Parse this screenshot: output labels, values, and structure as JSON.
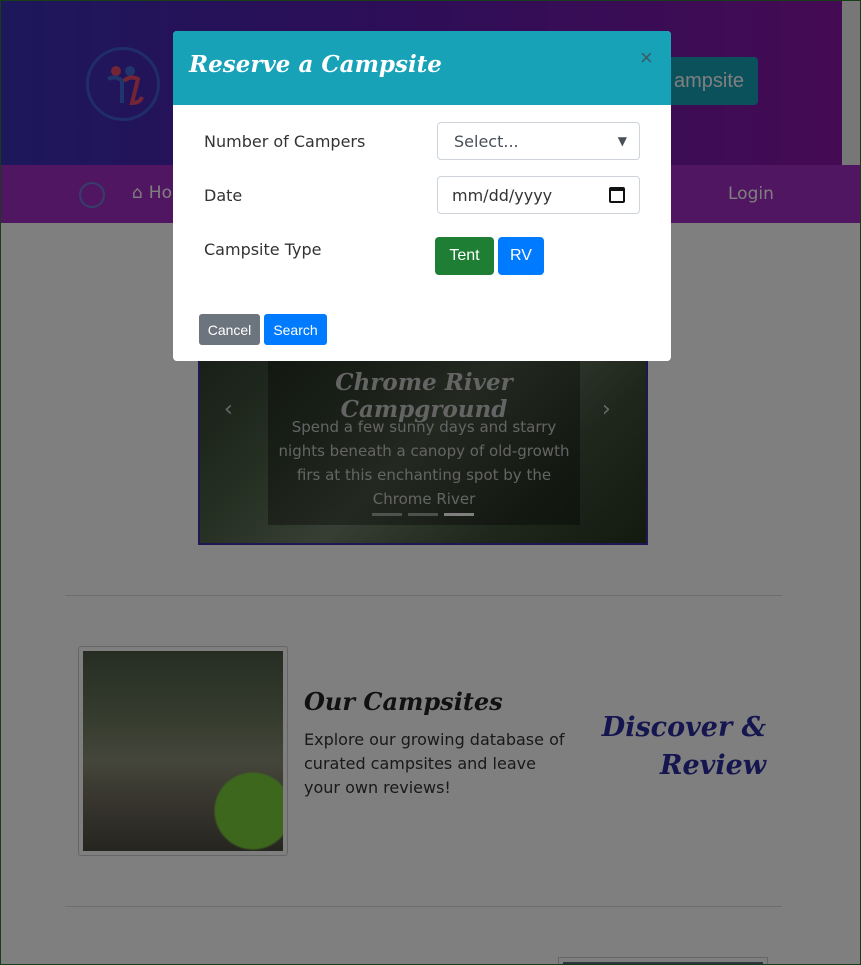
{
  "header": {
    "reserve_button_label": "ampsite"
  },
  "navbar": {
    "home_label": "Ho",
    "login_label": "Login"
  },
  "carousel": {
    "title": "Chrome River Campground",
    "text": "Spend a few sunny days and starry nights beneath a canopy of old-growth firs at this enchanting spot by the Chrome River",
    "active_slide": 3,
    "slide_count": 3
  },
  "campsites_section": {
    "title": "Our Campsites",
    "text": "Explore our growing database of curated campsites and leave your own reviews!",
    "tagline_line1": "Discover &",
    "tagline_line2": "Review"
  },
  "modal": {
    "title": "Reserve a Campsite",
    "close_symbol": "×",
    "campers_label": "Number of Campers",
    "campers_select_value": "Select...",
    "date_label": "Date",
    "date_placeholder": "mm/dd/yyyy",
    "type_label": "Campsite Type",
    "tent_label": "Tent",
    "rv_label": "RV",
    "cancel_label": "Cancel",
    "search_label": "Search"
  },
  "colors": {
    "modal_header": "#17a2b8",
    "tent_button": "#1e7e34",
    "primary_button": "#007bff",
    "cancel_button": "#6c757d",
    "navbar": "#a32cc4"
  }
}
